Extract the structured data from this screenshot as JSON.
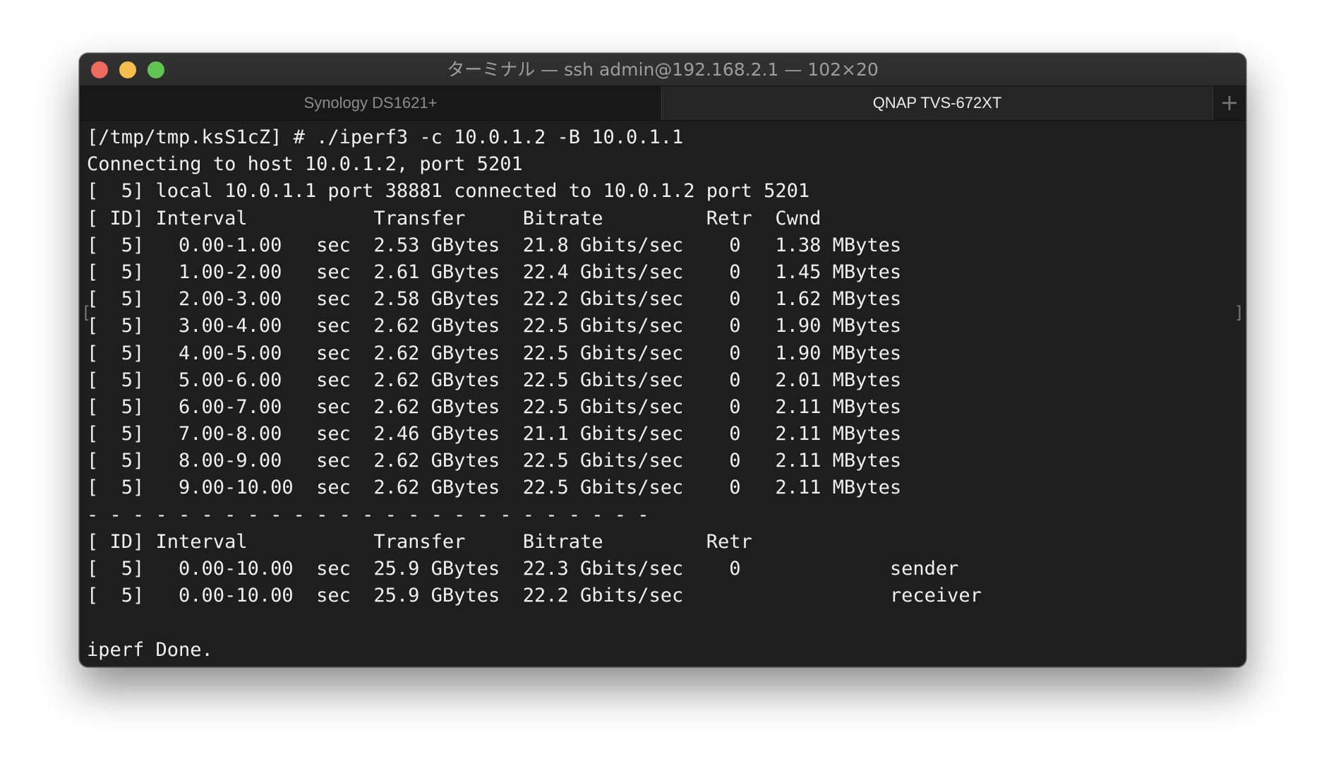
{
  "window": {
    "title": "ターミナル — ssh admin@192.168.2.1 — 102×20",
    "traffic_lights": {
      "close_color": "#ed6a5e",
      "minimize_color": "#f5bf4f",
      "zoom_color": "#61c554"
    }
  },
  "tabs": [
    {
      "label": "Synology DS1621+",
      "active": false
    },
    {
      "label": "QNAP TVS-672XT",
      "active": true
    }
  ],
  "new_tab_symbol": "+",
  "terminal": {
    "lines": [
      "[/tmp/tmp.ksS1cZ] # ./iperf3 -c 10.0.1.2 -B 10.0.1.1",
      "Connecting to host 10.0.1.2, port 5201",
      "[  5] local 10.0.1.1 port 38881 connected to 10.0.1.2 port 5201",
      "[ ID] Interval           Transfer     Bitrate         Retr  Cwnd",
      "[  5]   0.00-1.00   sec  2.53 GBytes  21.8 Gbits/sec    0   1.38 MBytes",
      "[  5]   1.00-2.00   sec  2.61 GBytes  22.4 Gbits/sec    0   1.45 MBytes",
      "[  5]   2.00-3.00   sec  2.58 GBytes  22.2 Gbits/sec    0   1.62 MBytes",
      "[  5]   3.00-4.00   sec  2.62 GBytes  22.5 Gbits/sec    0   1.90 MBytes",
      "[  5]   4.00-5.00   sec  2.62 GBytes  22.5 Gbits/sec    0   1.90 MBytes",
      "[  5]   5.00-6.00   sec  2.62 GBytes  22.5 Gbits/sec    0   2.01 MBytes",
      "[  5]   6.00-7.00   sec  2.62 GBytes  22.5 Gbits/sec    0   2.11 MBytes",
      "[  5]   7.00-8.00   sec  2.46 GBytes  21.1 Gbits/sec    0   2.11 MBytes",
      "[  5]   8.00-9.00   sec  2.62 GBytes  22.5 Gbits/sec    0   2.11 MBytes",
      "[  5]   9.00-10.00  sec  2.62 GBytes  22.5 Gbits/sec    0   2.11 MBytes",
      "- - - - - - - - - - - - - - - - - - - - - - - - -",
      "[ ID] Interval           Transfer     Bitrate         Retr",
      "[  5]   0.00-10.00  sec  25.9 GBytes  22.3 Gbits/sec    0             sender",
      "[  5]   0.00-10.00  sec  25.9 GBytes  22.2 Gbits/sec                  receiver",
      "",
      "iperf Done."
    ]
  }
}
